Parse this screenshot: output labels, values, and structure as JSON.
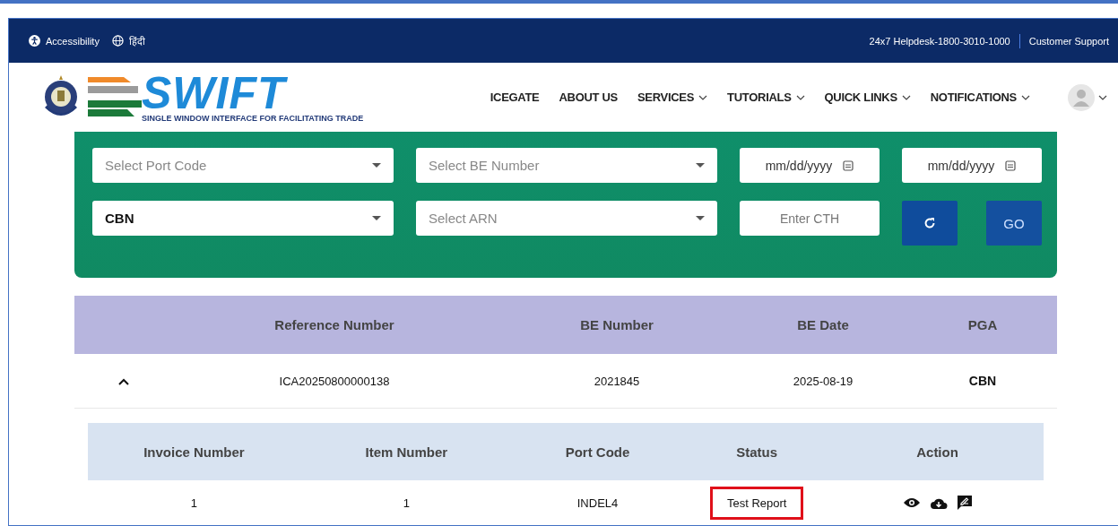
{
  "top_bar": {
    "accessibility": "Accessibility",
    "language": "हिंदी",
    "helpdesk": "24x7 Helpdesk-1800-3010-1000",
    "support": "Customer Support"
  },
  "logo": {
    "wordmark": "SWIFT",
    "tagline": "SINGLE WINDOW INTERFACE FOR FACILITATING TRADE"
  },
  "nav": [
    {
      "label": "ICEGATE",
      "dropdown": false
    },
    {
      "label": "ABOUT US",
      "dropdown": false
    },
    {
      "label": "SERVICES",
      "dropdown": true
    },
    {
      "label": "TUTORIALS",
      "dropdown": true
    },
    {
      "label": "QUICK LINKS",
      "dropdown": true
    },
    {
      "label": "NOTIFICATIONS",
      "dropdown": true
    }
  ],
  "filters": {
    "port_code": {
      "placeholder": "Select Port Code"
    },
    "be_number": {
      "placeholder": "Select BE Number"
    },
    "date_from": {
      "placeholder": "mm/dd/yyyy"
    },
    "date_to": {
      "placeholder": "mm/dd/yyyy"
    },
    "pga": {
      "value": "CBN"
    },
    "arn": {
      "placeholder": "Select ARN"
    },
    "cth": {
      "placeholder": "Enter CTH"
    },
    "go": "GO"
  },
  "table": {
    "columns": [
      "Reference Number",
      "BE Number",
      "BE Date",
      "PGA"
    ],
    "rows": [
      {
        "expanded": true,
        "cells": [
          "ICA20250800000138",
          "2021845",
          "2025-08-19",
          "CBN"
        ],
        "sub_table": {
          "columns": [
            "Invoice Number",
            "Item Number",
            "Port Code",
            "Status",
            "Action"
          ],
          "rows": [
            {
              "cells": [
                "1",
                "1",
                "INDEL4"
              ],
              "status": "Test Report",
              "status_highlighted": true
            }
          ]
        }
      }
    ]
  }
}
